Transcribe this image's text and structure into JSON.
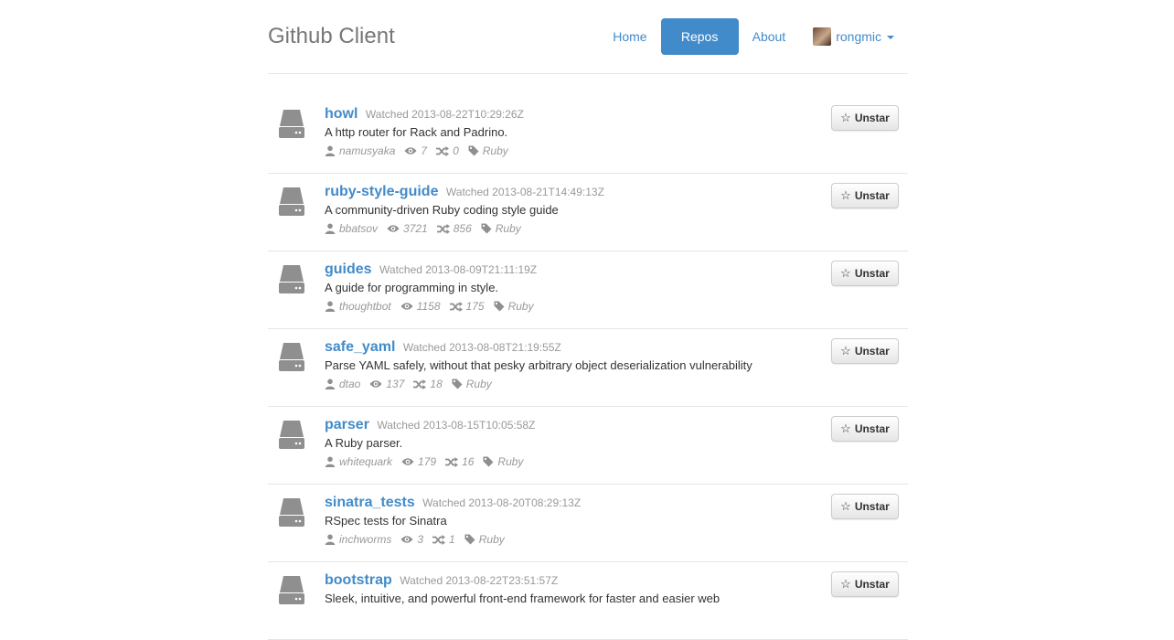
{
  "app": {
    "title": "Github Client"
  },
  "nav": {
    "items": [
      {
        "label": "Home",
        "active": false
      },
      {
        "label": "Repos",
        "active": true
      },
      {
        "label": "About",
        "active": false
      }
    ],
    "user": {
      "name": "rongmic"
    }
  },
  "colors": {
    "accent": "#428bca",
    "muted": "#999999",
    "text": "#333333",
    "icon_gray": "#8f8f8f"
  },
  "icons": {
    "repo": "hdd-icon",
    "owner": "user-icon",
    "watchers": "eye-icon",
    "forks": "shuffle-icon",
    "language": "tag-icon",
    "star": "star-icon"
  },
  "repos": [
    {
      "name": "howl",
      "watched": "Watched 2013-08-22T10:29:26Z",
      "description": "A http router for Rack and Padrino.",
      "owner": "namusyaka",
      "watchers": "7",
      "forks": "0",
      "language": "Ruby",
      "action": "Unstar"
    },
    {
      "name": "ruby-style-guide",
      "watched": "Watched 2013-08-21T14:49:13Z",
      "description": "A community-driven Ruby coding style guide",
      "owner": "bbatsov",
      "watchers": "3721",
      "forks": "856",
      "language": "Ruby",
      "action": "Unstar"
    },
    {
      "name": "guides",
      "watched": "Watched 2013-08-09T21:11:19Z",
      "description": "A guide for programming in style.",
      "owner": "thoughtbot",
      "watchers": "1158",
      "forks": "175",
      "language": "Ruby",
      "action": "Unstar"
    },
    {
      "name": "safe_yaml",
      "watched": "Watched 2013-08-08T21:19:55Z",
      "description": "Parse YAML safely, without that pesky arbitrary object deserialization vulnerability",
      "owner": "dtao",
      "watchers": "137",
      "forks": "18",
      "language": "Ruby",
      "action": "Unstar"
    },
    {
      "name": "parser",
      "watched": "Watched 2013-08-15T10:05:58Z",
      "description": "A Ruby parser.",
      "owner": "whitequark",
      "watchers": "179",
      "forks": "16",
      "language": "Ruby",
      "action": "Unstar"
    },
    {
      "name": "sinatra_tests",
      "watched": "Watched 2013-08-20T08:29:13Z",
      "description": "RSpec tests for Sinatra",
      "owner": "inchworms",
      "watchers": "3",
      "forks": "1",
      "language": "Ruby",
      "action": "Unstar"
    },
    {
      "name": "bootstrap",
      "watched": "Watched 2013-08-22T23:51:57Z",
      "description": "Sleek, intuitive, and powerful front-end framework for faster and easier web",
      "owner": "",
      "watchers": "",
      "forks": "",
      "language": "",
      "action": "Unstar"
    }
  ]
}
